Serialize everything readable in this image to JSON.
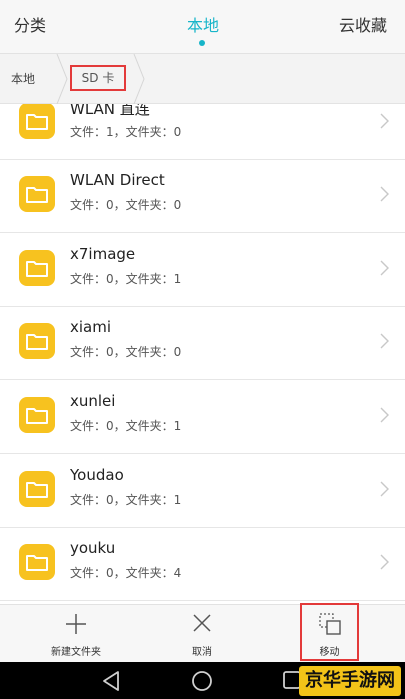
{
  "tabs": [
    {
      "label": "分类",
      "active": false
    },
    {
      "label": "本地",
      "active": true
    },
    {
      "label": "云收藏",
      "active": false
    }
  ],
  "breadcrumb": {
    "home": "本地",
    "current": "SD 卡"
  },
  "files": [
    {
      "name": "WLAN 直连",
      "meta": "文件：1，文件夹：0"
    },
    {
      "name": "WLAN Direct",
      "meta": "文件：0，文件夹：0"
    },
    {
      "name": "x7image",
      "meta": "文件：0，文件夹：1"
    },
    {
      "name": "xiami",
      "meta": "文件：0，文件夹：0"
    },
    {
      "name": "xunlei",
      "meta": "文件：0，文件夹：1"
    },
    {
      "name": "Youdao",
      "meta": "文件：0，文件夹：1"
    },
    {
      "name": "youku",
      "meta": "文件：0，文件夹：4"
    }
  ],
  "actions": {
    "new_folder": "新建文件夹",
    "cancel": "取消",
    "move": "移动"
  },
  "watermark": "京华手游网",
  "colors": {
    "accent": "#17b5c9",
    "folder": "#f7c21f",
    "highlight": "#e33a3a"
  }
}
